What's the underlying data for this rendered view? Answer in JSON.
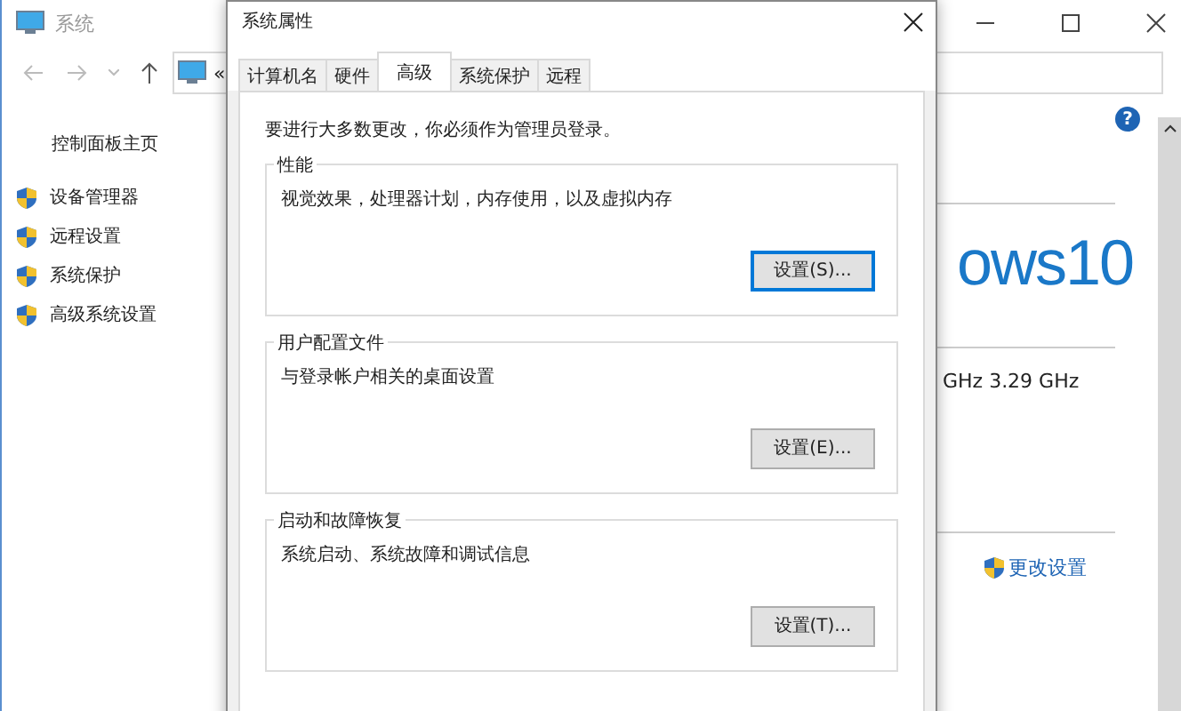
{
  "system_window": {
    "title": "系统",
    "address_chevron": "«",
    "sidebar_home": "控制面板主页",
    "sidebar_items": [
      {
        "label": "设备管理器"
      },
      {
        "label": "远程设置"
      },
      {
        "label": "系统保护"
      },
      {
        "label": "高级系统设置"
      }
    ],
    "help": "?",
    "brand_text": "ows10",
    "cpu_text": "GHz   3.29 GHz",
    "change_settings": "更改设置"
  },
  "dialog": {
    "title": "系统属性",
    "tabs": [
      {
        "label": "计算机名",
        "selected": false
      },
      {
        "label": "硬件",
        "selected": false
      },
      {
        "label": "高级",
        "selected": true
      },
      {
        "label": "系统保护",
        "selected": false
      },
      {
        "label": "远程",
        "selected": false
      }
    ],
    "notice": "要进行大多数更改，你必须作为管理员登录。",
    "groups": [
      {
        "title": "性能",
        "description": "视觉效果，处理器计划，内存使用，以及虚拟内存",
        "button": "设置(S)...",
        "focused": true
      },
      {
        "title": "用户配置文件",
        "description": "与登录帐户相关的桌面设置",
        "button": "设置(E)...",
        "focused": false
      },
      {
        "title": "启动和故障恢复",
        "description": "系统启动、系统故障和调试信息",
        "button": "设置(T)...",
        "focused": false
      }
    ]
  }
}
